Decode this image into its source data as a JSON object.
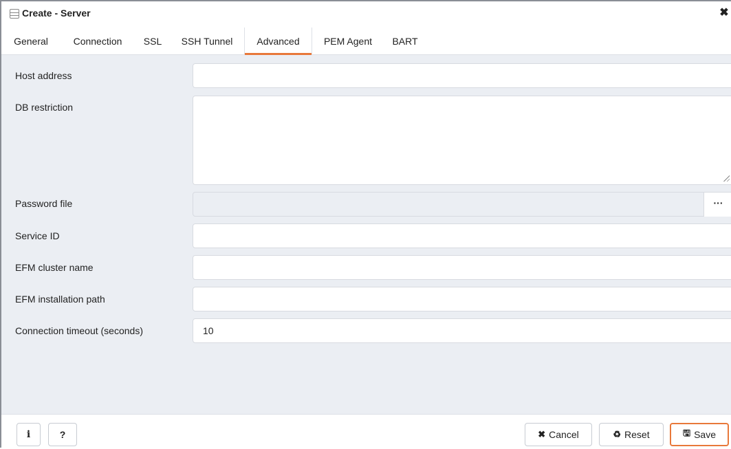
{
  "window": {
    "title": "Create - Server",
    "close_glyph": "✖"
  },
  "tabs": [
    {
      "label": "General",
      "active": false
    },
    {
      "label": "Connection",
      "active": false
    },
    {
      "label": "SSL",
      "active": false
    },
    {
      "label": "SSH Tunnel",
      "active": false
    },
    {
      "label": "Advanced",
      "active": true
    },
    {
      "label": "PEM Agent",
      "active": false
    },
    {
      "label": "BART",
      "active": false
    }
  ],
  "form": {
    "host_address": {
      "label": "Host address",
      "value": ""
    },
    "db_restriction": {
      "label": "DB restriction",
      "value": ""
    },
    "password_file": {
      "label": "Password file",
      "value": "",
      "browse_label": "···"
    },
    "service_id": {
      "label": "Service ID",
      "value": ""
    },
    "efm_cluster_name": {
      "label": "EFM cluster name",
      "value": ""
    },
    "efm_installation_path": {
      "label": "EFM installation path",
      "value": ""
    },
    "connection_timeout": {
      "label": "Connection timeout (seconds)",
      "value": "10"
    }
  },
  "footer": {
    "info_label": "i",
    "help_label": "?",
    "cancel_label": "Cancel",
    "cancel_icon": "✖",
    "reset_label": "Reset",
    "reset_icon": "♻",
    "save_label": "Save",
    "save_icon": "🖫"
  },
  "colors": {
    "accent": "#e8783a",
    "panel_bg": "#ebeef3"
  }
}
